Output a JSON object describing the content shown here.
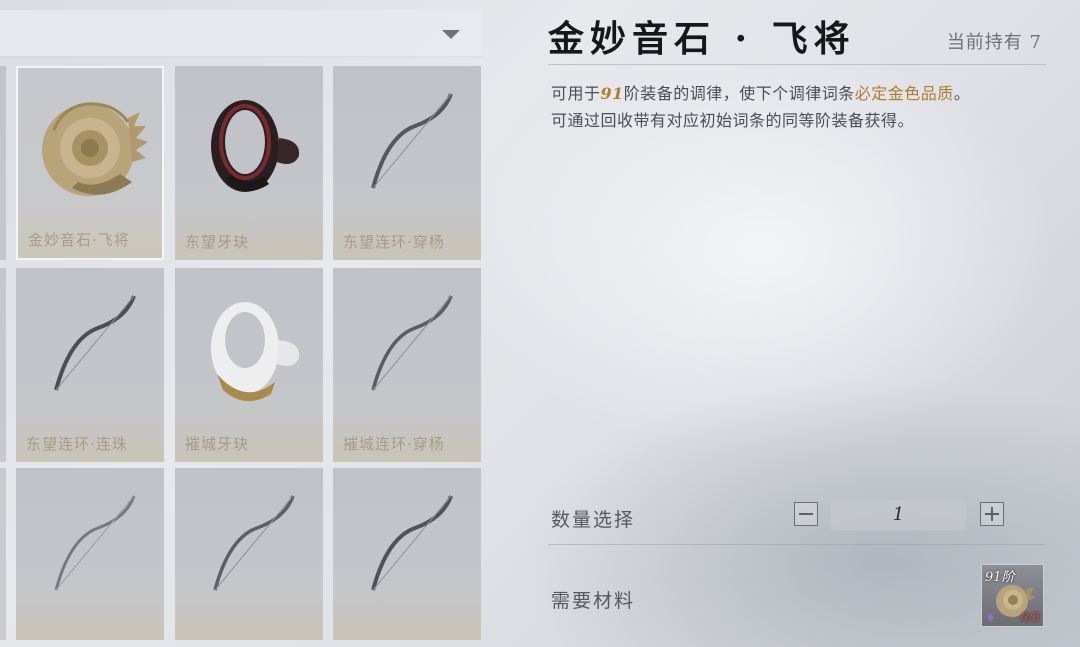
{
  "item": {
    "title": "金妙音石 · 飞将",
    "owned": "当前持有 7"
  },
  "description": {
    "line1_prefix": "可用于",
    "line1_tier": "91",
    "line1_middle": "阶装备的调律，使下个调律词条",
    "line1_highlight": "必定金色品质",
    "line1_suffix": "。",
    "line2": "可通过回收带有对应初始词条的同等阶装备获得。"
  },
  "quantity": {
    "label": "数量选择",
    "value": "1"
  },
  "materials": {
    "label": "需要材料",
    "tier": "91阶",
    "count": "0/3"
  },
  "grid": [
    {
      "label": "金妙音石·飞将",
      "icon": "conch-shell-icon",
      "selected": true
    },
    {
      "label": "东望牙玦",
      "icon": "dark-ring-icon"
    },
    {
      "label": "东望连环·穿杨",
      "icon": "bow-icon"
    },
    {
      "label": "东望连环·连珠",
      "icon": "bow-icon"
    },
    {
      "label": "摧城牙玦",
      "icon": "white-ring-icon"
    },
    {
      "label": "摧城连环·穿杨",
      "icon": "bow-icon"
    },
    {
      "label": "",
      "icon": "bow-icon"
    },
    {
      "label": "",
      "icon": "bow-icon"
    },
    {
      "label": "",
      "icon": "bow-icon"
    }
  ],
  "colors": {
    "accent_gold": "#b07c2c",
    "title": "#16171a",
    "count_red": "#e05050"
  }
}
